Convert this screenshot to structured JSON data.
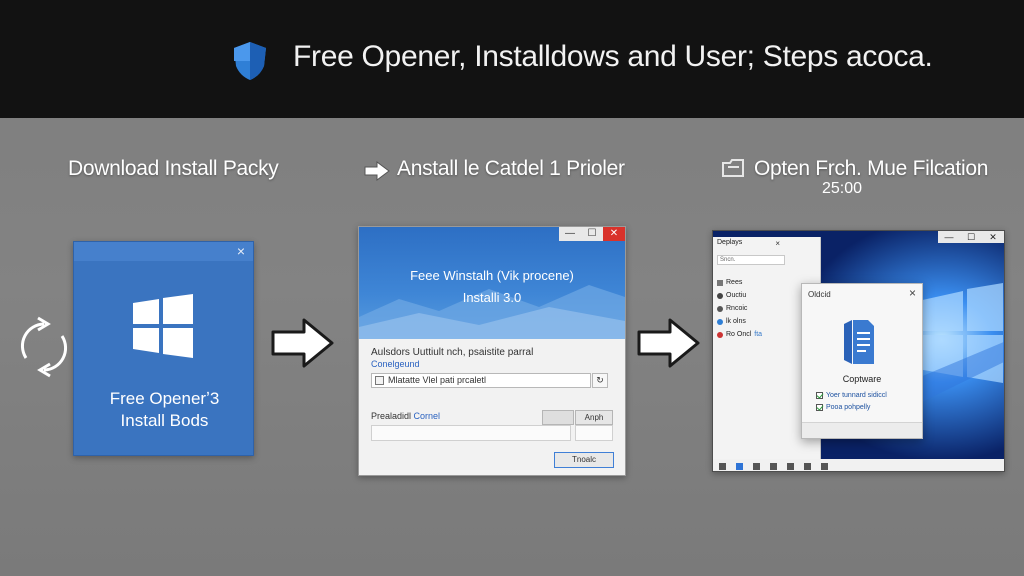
{
  "banner": {
    "title": "Free Opener, Installdows and User; Steps acoca.",
    "shield_icon": "shield-icon",
    "accent": "#2f7fd6"
  },
  "steps": {
    "one": {
      "title": "Download Install Packy"
    },
    "two": {
      "title": "Anstall le Catdel 1 Prioler"
    },
    "three": {
      "title": "Opten Frch. Mue Filcation",
      "time": "25:00"
    }
  },
  "card1": {
    "close": "×",
    "line1": "Free Openerʼ3",
    "line2": "Install Bods",
    "color": "#3a74c0"
  },
  "installer": {
    "controls": {
      "minimize": "—",
      "maximize": "☐",
      "close": "✕"
    },
    "title_line1": "Feee Winstalh (Vik procene)",
    "title_line2": "Installi 3.0",
    "desc": "Aulsdors Uuttiult nch, psaistite parral",
    "link": "Conelgeund",
    "field_value": "Mlatatte Vlel pati prcaletl",
    "browse": "↻",
    "label": "Prealadidl",
    "label_blue": "Cornel",
    "button_b": "Anph",
    "finish": "Tnoalc"
  },
  "desktop": {
    "controls": {
      "minimize": "—",
      "maximize": "☐",
      "close": "✕"
    },
    "explorer": {
      "title": "Deplays",
      "close": "×",
      "search": "Sncn.",
      "items": [
        {
          "label": "Rees"
        },
        {
          "label": "Ouctiu"
        },
        {
          "label": "Rncoic"
        },
        {
          "label": "lk  olns"
        },
        {
          "label": "Ro  Oncl",
          "extra": "fta"
        }
      ]
    },
    "dialog": {
      "title": "Oldcid",
      "close": "×",
      "name": "Coptware",
      "opt1": "Yoer tunnard sidiccl",
      "opt2": "Pooa pohpelly"
    }
  }
}
